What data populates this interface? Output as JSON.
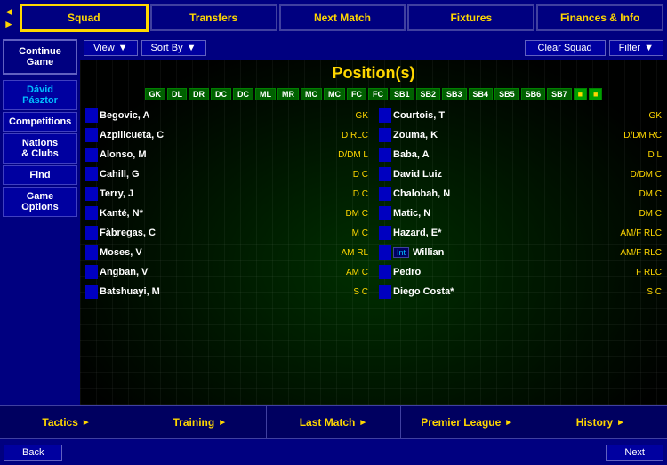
{
  "topNav": {
    "arrows": [
      "◄",
      "►"
    ],
    "tabs": [
      {
        "label": "Squad",
        "active": true
      },
      {
        "label": "Transfers",
        "active": false
      },
      {
        "label": "Next Match",
        "active": false
      },
      {
        "label": "Fixtures",
        "active": false
      },
      {
        "label": "Finances & Info",
        "active": false
      }
    ]
  },
  "sidebar": {
    "continueLabel": "Continue\nGame",
    "playerName": "Dávid\nPásztor",
    "items": [
      {
        "label": "Competitions"
      },
      {
        "label": "Nations\n& Clubs"
      },
      {
        "label": "Find"
      },
      {
        "label": "Game\nOptions"
      }
    ]
  },
  "subToolbar": {
    "viewLabel": "View",
    "sortByLabel": "Sort By",
    "clearSquadLabel": "Clear Squad",
    "filterLabel": "Filter"
  },
  "main": {
    "positionsTitle": "Position(s)",
    "positionTags": [
      "GK",
      "DL",
      "DR",
      "DC",
      "DC",
      "ML",
      "MR",
      "MC",
      "MC",
      "FC",
      "FC",
      "SB1",
      "SB2",
      "SB3",
      "SB4",
      "SB5",
      "SB6",
      "SB7",
      "",
      ""
    ],
    "leftPlayers": [
      {
        "name": "Begovic, A",
        "pos": "GK"
      },
      {
        "name": "Azpilicueta, C",
        "pos": "D RLC"
      },
      {
        "name": "Alonso, M",
        "pos": "D/DM L"
      },
      {
        "name": "Cahill, G",
        "pos": "D C"
      },
      {
        "name": "Terry, J",
        "pos": "D C"
      },
      {
        "name": "Kanté, N*",
        "pos": "DM C"
      },
      {
        "name": "Fàbregas, C",
        "pos": "M C"
      },
      {
        "name": "Moses, V",
        "pos": "AM RL"
      },
      {
        "name": "Angban, V",
        "pos": "AM C"
      },
      {
        "name": "Batshuayi, M",
        "pos": "S C"
      }
    ],
    "rightPlayers": [
      {
        "name": "Courtois, T",
        "pos": "GK",
        "int": false
      },
      {
        "name": "Zouma, K",
        "pos": "D/DM RC",
        "int": false
      },
      {
        "name": "Baba, A",
        "pos": "D L",
        "int": false
      },
      {
        "name": "David Luiz",
        "pos": "D/DM C",
        "int": false
      },
      {
        "name": "Chalobah, N",
        "pos": "DM C",
        "int": false
      },
      {
        "name": "Matic, N",
        "pos": "DM C",
        "int": false
      },
      {
        "name": "Hazard, E*",
        "pos": "AM/F RLC",
        "int": false
      },
      {
        "name": "Willian",
        "pos": "AM/F RLC",
        "int": true
      },
      {
        "name": "Pedro",
        "pos": "F RLC",
        "int": false
      },
      {
        "name": "Diego Costa*",
        "pos": "S C",
        "int": false
      }
    ]
  },
  "bottomNav": {
    "tabs": [
      {
        "label": "Tactics",
        "arrow": "►"
      },
      {
        "label": "Training",
        "arrow": "►"
      },
      {
        "label": "Last Match",
        "arrow": "►"
      },
      {
        "label": "Premier League",
        "arrow": "►"
      },
      {
        "label": "History",
        "arrow": "►"
      }
    ]
  },
  "veryBottom": {
    "backLabel": "Back",
    "nextLabel": "Next"
  }
}
